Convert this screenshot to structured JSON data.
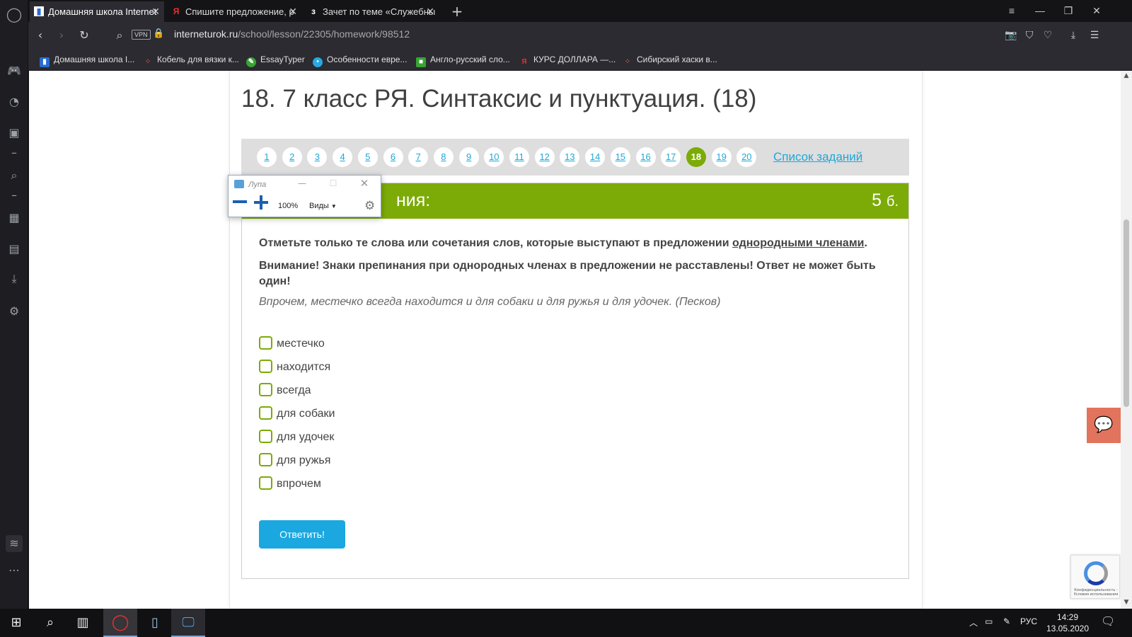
{
  "browser": {
    "tabs": [
      {
        "label": "Домашняя школа Internet",
        "favicon": "book-icon",
        "active": true
      },
      {
        "label": "Спишите предложение, р",
        "favicon": "yandex-icon",
        "active": false
      },
      {
        "label": "Зачет по теме «Служебны",
        "favicon": "znanija-icon",
        "active": false
      }
    ],
    "url_host": "interneturok.ru",
    "url_path": "/school/lesson/22305/homework/98512",
    "vpn_label": "VPN",
    "bookmarks": [
      {
        "label": "Домашняя школа I...",
        "icon": "book-icon",
        "color": "#2a6bd1"
      },
      {
        "label": "Кобель для вязки к...",
        "icon": "dots-icon",
        "color": "#e84d3d"
      },
      {
        "label": "EssayTyper",
        "icon": "pen-icon",
        "color": "#3aa335"
      },
      {
        "label": "Особенности евре...",
        "icon": "circle-icon",
        "color": "#27a9e1"
      },
      {
        "label": "Англо-русский сло...",
        "icon": "square-icon",
        "color": "#3aa335"
      },
      {
        "label": "КУРС ДОЛЛАРА —...",
        "icon": "yandex-icon",
        "color": "#e8322d"
      },
      {
        "label": "Сибирский хаски в...",
        "icon": "dots-icon",
        "color": "#e84d3d"
      }
    ]
  },
  "page": {
    "title": "18. 7 класс РЯ. Синтаксис и пунктуация. (18)",
    "question_numbers": [
      "1",
      "2",
      "3",
      "4",
      "5",
      "6",
      "7",
      "8",
      "9",
      "10",
      "11",
      "12",
      "13",
      "14",
      "15",
      "16",
      "17",
      "18",
      "19",
      "20"
    ],
    "current_question": "18",
    "task_list_link": "Список заданий",
    "header_title_visible": "ния:",
    "points_value": "5",
    "points_unit": "б.",
    "instruction_before": "Отметьте только те слова или сочетания слов, которые выступают в предложении ",
    "instruction_underlined": "однородными членами",
    "instruction_after": ".",
    "warning": "Внимание! Знаки препинания при однородных членах в предложении не расставлены! Ответ не может быть один!",
    "sentence": "Впрочем, местечко всегда находится и для собаки и для ружья и для удочек. (Песков)",
    "options": [
      "местечко",
      "находится",
      "всегда",
      "для собаки",
      "для удочек",
      "для ружья",
      "впрочем"
    ],
    "submit_label": "Ответить!",
    "recaptcha_text": "Конфиденциальность - Условия использования"
  },
  "magnifier": {
    "title": "Лупа",
    "zoom": "100%",
    "views_label": "Виды"
  },
  "taskbar": {
    "language": "РУС",
    "time": "14:29",
    "date": "13.05.2020"
  },
  "colors": {
    "accent_green": "#7cab07",
    "link_blue": "#20a7d8",
    "button_blue": "#1ba7e0",
    "chat_orange": "#e2735c"
  }
}
